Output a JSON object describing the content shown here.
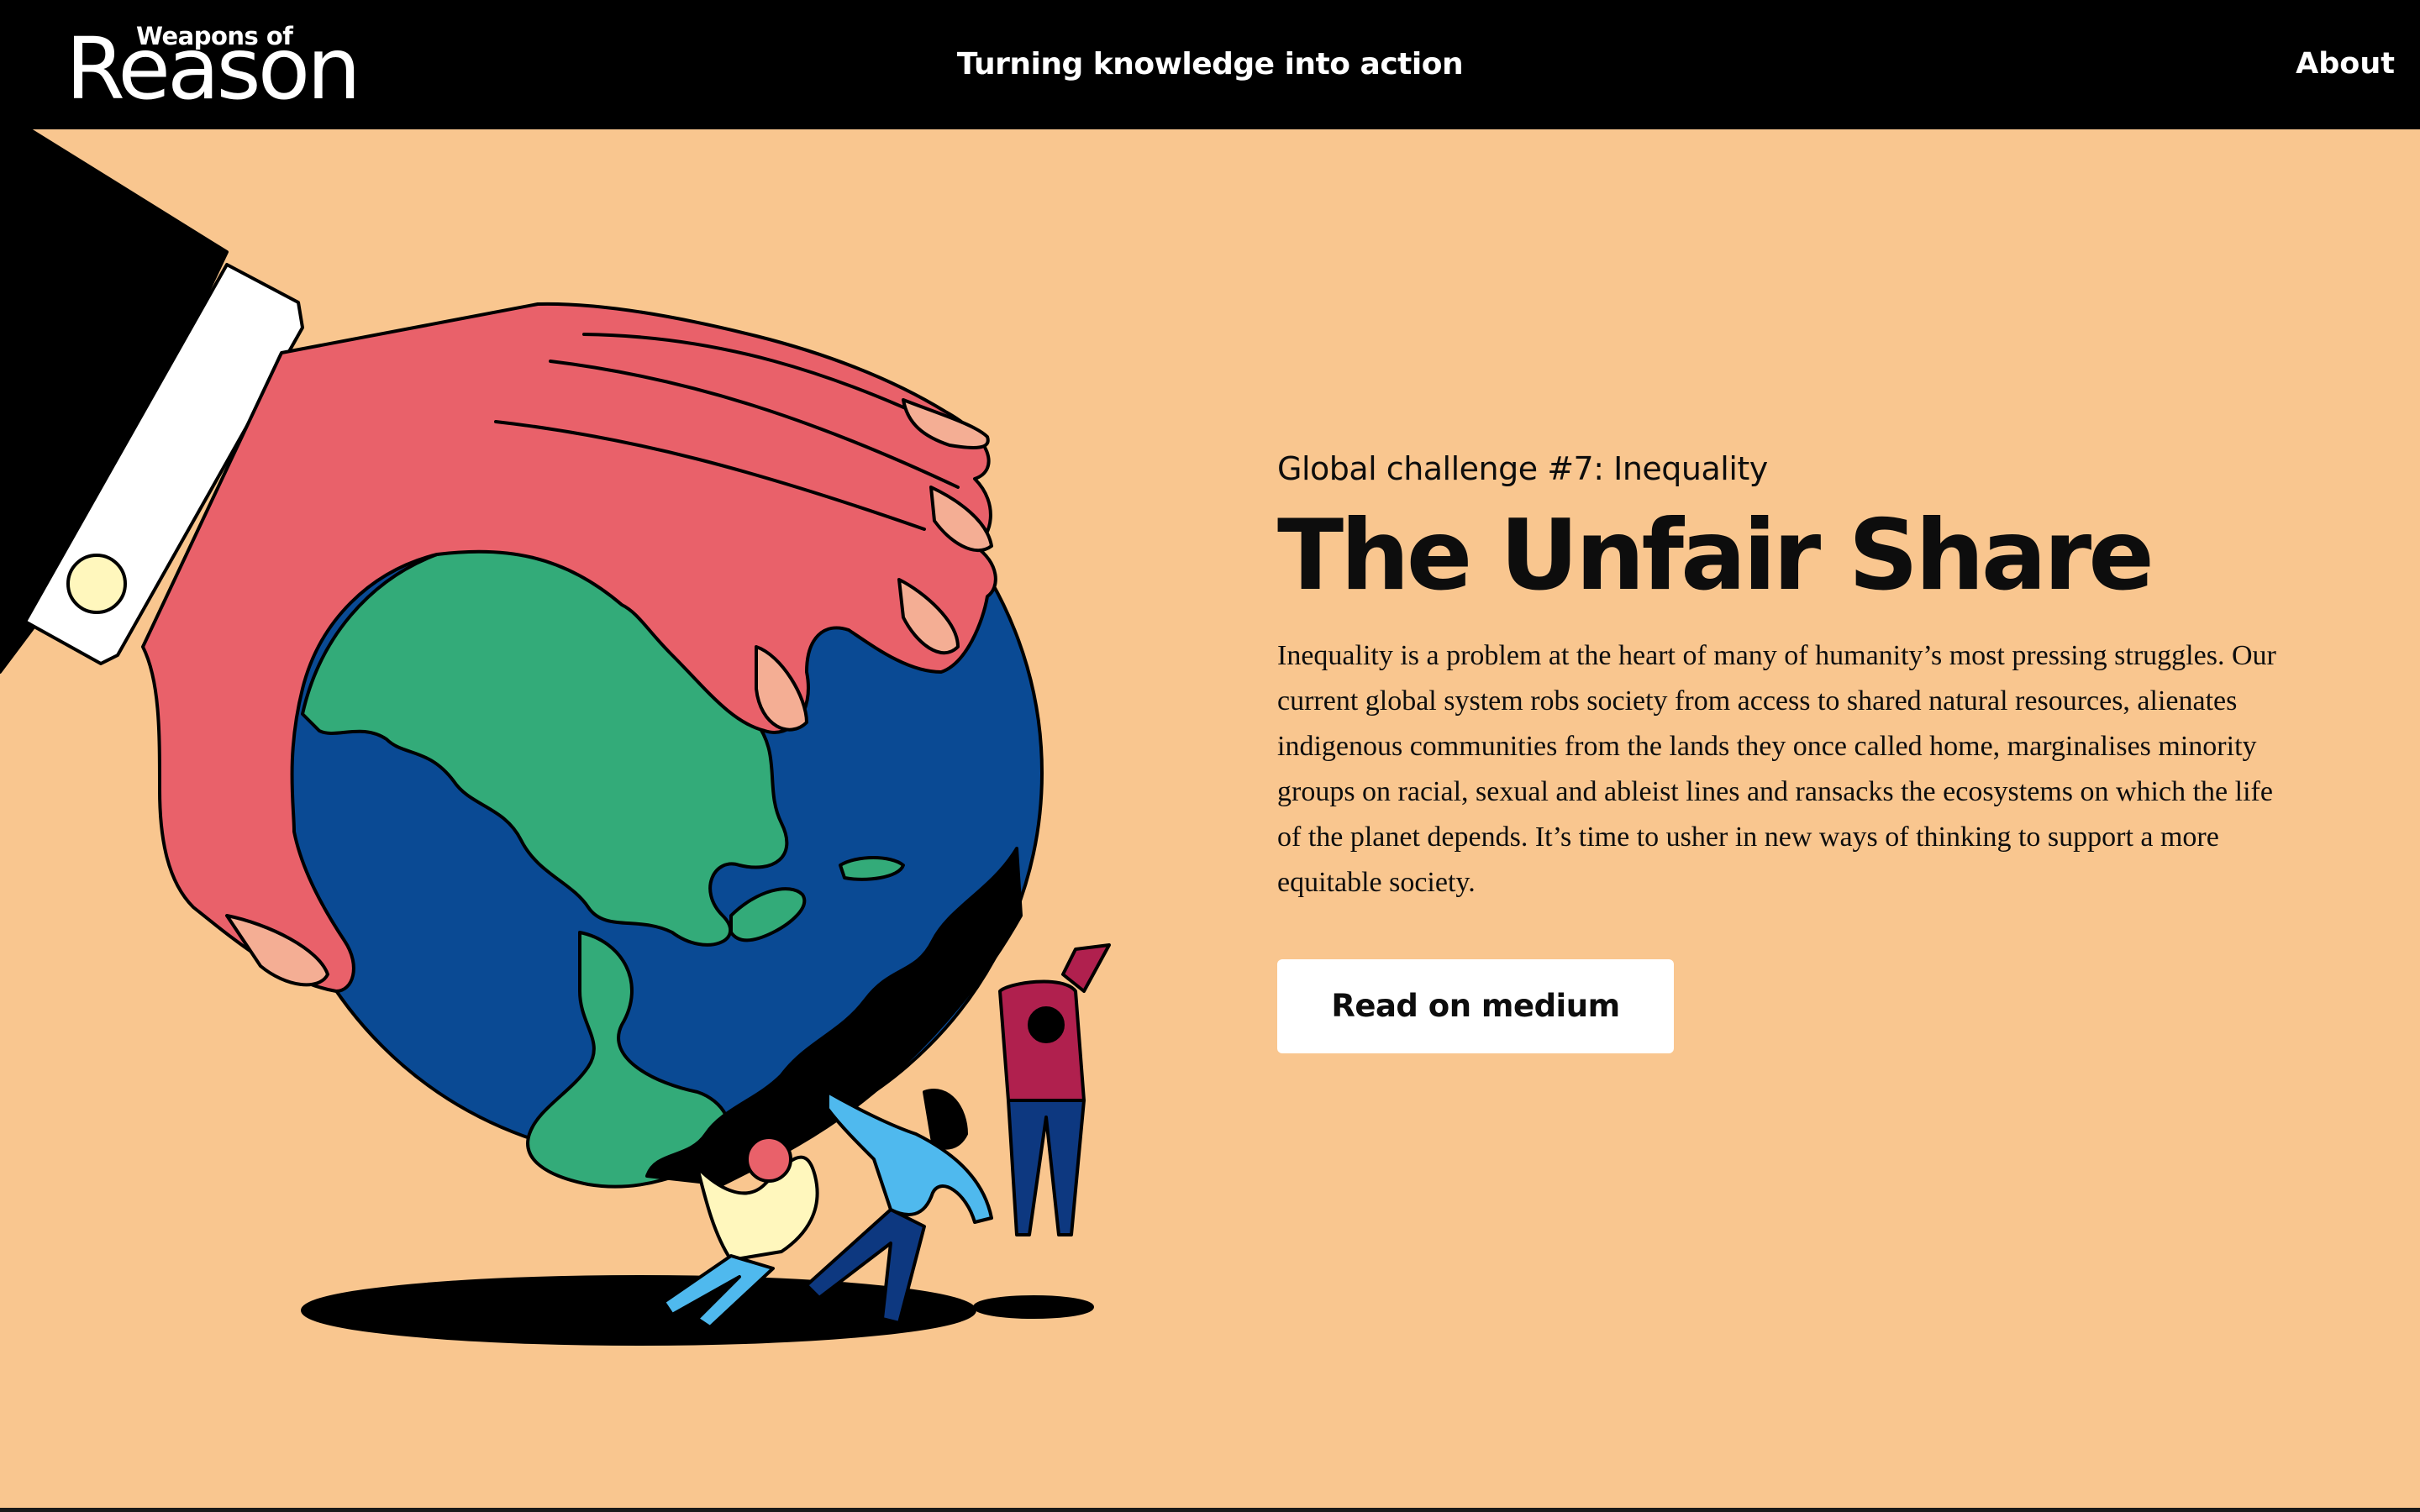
{
  "brand": {
    "logo_small": "Weapons of",
    "logo_big": "Reason"
  },
  "header": {
    "tagline": "Turning knowledge into action",
    "about_label": "About"
  },
  "hero": {
    "eyebrow": "Global challenge #7: Inequality",
    "title": "The Unfair Share",
    "body": "Inequality is a problem at the heart of many of humanity’s most pressing struggles. Our current global system robs society from access to shared natural resources, alienates indigenous communities from the lands they once called home, marginalises minority groups on racial, sexual and ableist lines and ransacks the ecosystems on which the life of the planet depends. It’s time to usher in new ways of thinking to support a more equitable society.",
    "cta_label": "Read on medium"
  },
  "illustration": {
    "subject": "giant hand grabbing the Earth while small people pull on a piece of it",
    "icon": "globe-hand-illustration"
  },
  "colors": {
    "background": "#f9c68f",
    "header": "#000000",
    "hand": "#e9616a",
    "ocean": "#0a4a94",
    "land": "#33ab79",
    "cuff": "#ffffff",
    "button": "#ffffff"
  }
}
